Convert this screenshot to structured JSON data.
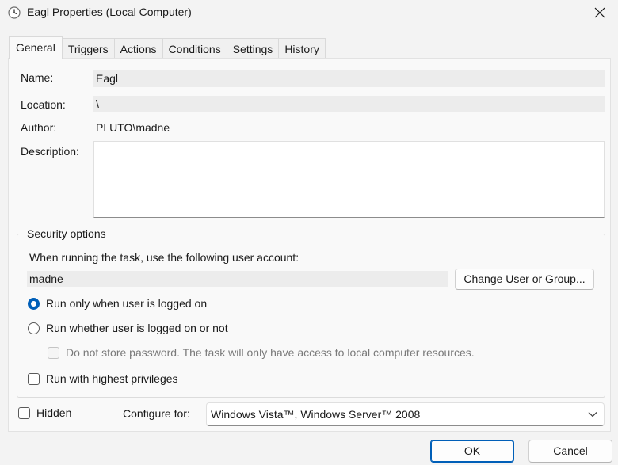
{
  "window": {
    "title": "Eagl Properties (Local Computer)",
    "icon": "task-scheduler-clock-icon",
    "close_icon": "close-icon"
  },
  "tabs": [
    {
      "label": "General",
      "active": true
    },
    {
      "label": "Triggers",
      "active": false
    },
    {
      "label": "Actions",
      "active": false
    },
    {
      "label": "Conditions",
      "active": false
    },
    {
      "label": "Settings",
      "active": false
    },
    {
      "label": "History",
      "active": false
    }
  ],
  "general": {
    "name_label": "Name:",
    "name_value": "Eagl",
    "location_label": "Location:",
    "location_value": "\\",
    "author_label": "Author:",
    "author_value": "PLUTO\\madne",
    "description_label": "Description:",
    "description_value": ""
  },
  "security": {
    "group_title": "Security options",
    "account_prompt": "When running the task, use the following user account:",
    "account_value": "madne",
    "change_button": "Change User or Group...",
    "radio_logged_on": {
      "label": "Run only when user is logged on",
      "checked": true
    },
    "radio_whether": {
      "label": "Run whether user is logged on or not",
      "checked": false
    },
    "no_store_password": {
      "label": "Do not store password.  The task will only have access to local computer resources.",
      "checked": false,
      "enabled": false
    },
    "highest_privileges": {
      "label": "Run with highest privileges",
      "checked": false
    }
  },
  "footer": {
    "hidden": {
      "label": "Hidden",
      "checked": false
    },
    "configure_label": "Configure for:",
    "configure_value": "Windows Vista™, Windows Server™ 2008"
  },
  "buttons": {
    "ok": "OK",
    "cancel": "Cancel"
  },
  "colors": {
    "accent": "#005fb8",
    "window_bg": "#f3f3f3",
    "panel_bg": "#f9f9f9"
  }
}
